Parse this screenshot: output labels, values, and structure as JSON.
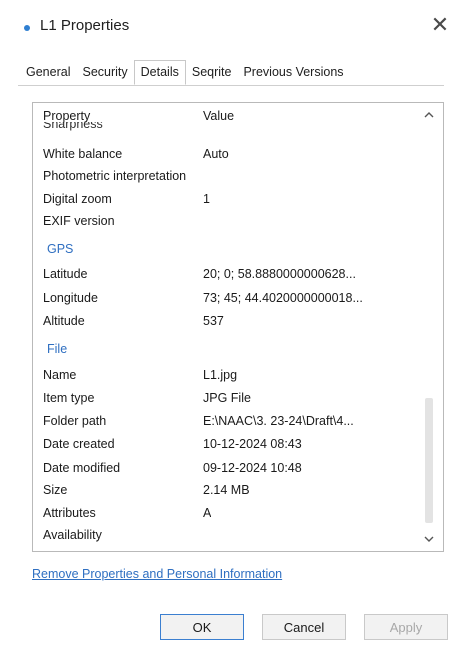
{
  "window": {
    "title": "L1 Properties",
    "close_label": "✕"
  },
  "tabs": [
    {
      "label": "General"
    },
    {
      "label": "Security"
    },
    {
      "label": "Details",
      "active": true
    },
    {
      "label": "Seqrite"
    },
    {
      "label": "Previous Versions"
    }
  ],
  "list": {
    "header_property": "Property",
    "header_value": "Value",
    "cut_row": "Sharpness",
    "rows_top": [
      {
        "prop": "White balance",
        "value": "Auto"
      },
      {
        "prop": "Photometric interpretation",
        "value": ""
      },
      {
        "prop": "Digital zoom",
        "value": "1"
      },
      {
        "prop": "EXIF version",
        "value": ""
      }
    ],
    "section_gps": "GPS",
    "rows_gps": [
      {
        "prop": "Latitude",
        "value": "20; 0; 58.8880000000628..."
      },
      {
        "prop": "Longitude",
        "value": "73; 45; 44.4020000000018..."
      },
      {
        "prop": "Altitude",
        "value": "537"
      }
    ],
    "section_file": "File",
    "rows_file": [
      {
        "prop": "Name",
        "value": "L1.jpg"
      },
      {
        "prop": "Item type",
        "value": "JPG File"
      },
      {
        "prop": "Folder path",
        "value": "E:\\NAAC\\3. 23-24\\Draft\\4..."
      },
      {
        "prop": "Date created",
        "value": "10-12-2024 08:43"
      },
      {
        "prop": "Date modified",
        "value": "09-12-2024 10:48"
      },
      {
        "prop": "Size",
        "value": "2.14 MB"
      },
      {
        "prop": "Attributes",
        "value": "A"
      },
      {
        "prop": "Availability",
        "value": ""
      }
    ],
    "scroll_up_icon": "chevron-up-icon",
    "scroll_down_icon": "chevron-down-icon"
  },
  "link": {
    "label": "Remove Properties and Personal Information"
  },
  "buttons": {
    "ok": "OK",
    "cancel": "Cancel",
    "apply": "Apply"
  },
  "colors": {
    "accent": "#2f6fc1",
    "ok_border": "#3b7fd0"
  }
}
